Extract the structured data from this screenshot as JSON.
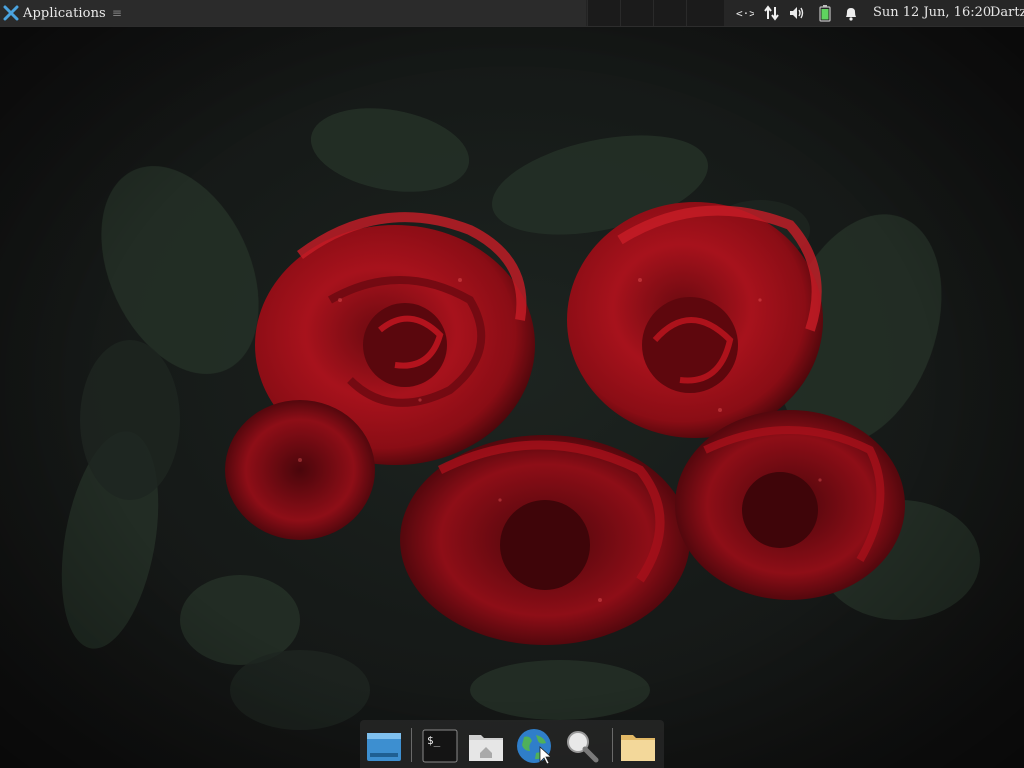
{
  "top_panel": {
    "applications_label": "Applications",
    "menu_grip": "≡",
    "clock": "Sun 12 Jun, 16:20",
    "user": "Dartz",
    "icons": [
      "network-wired-icon",
      "transfer-arrows-icon",
      "volume-icon",
      "battery-icon",
      "notification-bell-icon"
    ]
  },
  "dock": {
    "items": [
      "show-desktop-icon",
      "terminal-icon",
      "home-folder-icon",
      "web-browser-icon",
      "search-icon",
      "files-icon"
    ],
    "terminal_prompt": "$_"
  },
  "colors": {
    "panel": "#232323",
    "rose": "#b3121c",
    "leaf": "#2a3a2a",
    "battery": "#5fd35f"
  }
}
